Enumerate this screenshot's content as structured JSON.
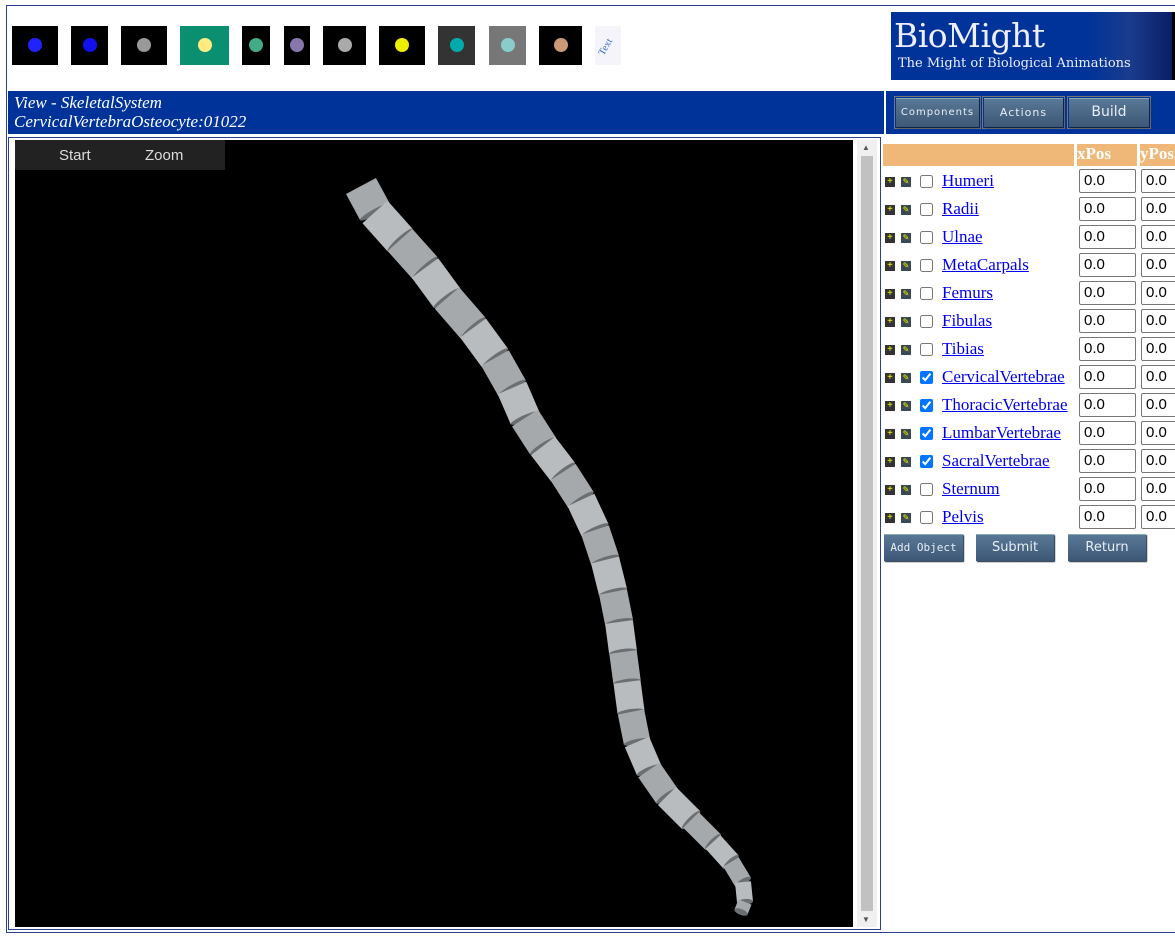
{
  "thumbnails": [
    {
      "name": "molecule-chain",
      "bg": "#000",
      "fg": "#22f"
    },
    {
      "name": "blue-spheres",
      "bg": "#000",
      "fg": "#11e"
    },
    {
      "name": "dna-helix",
      "bg": "#000",
      "fg": "#999"
    },
    {
      "name": "cell-diagram",
      "bg": "#0a9070",
      "fg": "#ffeb80"
    },
    {
      "name": "cell-small",
      "bg": "#000",
      "fg": "#4a8"
    },
    {
      "name": "cell-stack",
      "bg": "#000",
      "fg": "#87a"
    },
    {
      "name": "sphere-cell",
      "bg": "#000",
      "fg": "#aaa"
    },
    {
      "name": "colored-cubes",
      "bg": "#000",
      "fg": "#ee0"
    },
    {
      "name": "organ-model",
      "bg": "#333",
      "fg": "#0aa"
    },
    {
      "name": "lungs-model",
      "bg": "#777",
      "fg": "#8cc"
    },
    {
      "name": "human-torso",
      "bg": "#000",
      "fg": "#c97"
    },
    {
      "name": "text-icon",
      "bg": "#f4f4fa",
      "fg": "#36c",
      "label": "Text"
    }
  ],
  "logo": {
    "title": "BioMight",
    "subtitle": "The Might of Biological Animations"
  },
  "view": {
    "line1": "View - SkeletalSystem",
    "line2": "CervicalVertebraOsteocyte:01022"
  },
  "nav": {
    "components": "Components",
    "actions": "Actions",
    "build": "Build"
  },
  "viewer": {
    "start": "Start",
    "zoom": "Zoom"
  },
  "table": {
    "col_x": "xPos",
    "col_y": "yPos",
    "rows": [
      {
        "label": "Humeri",
        "checked": false,
        "x": "0.0",
        "y": "0.0"
      },
      {
        "label": "Radii",
        "checked": false,
        "x": "0.0",
        "y": "0.0"
      },
      {
        "label": "Ulnae",
        "checked": false,
        "x": "0.0",
        "y": "0.0"
      },
      {
        "label": "MetaCarpals",
        "checked": false,
        "x": "0.0",
        "y": "0.0"
      },
      {
        "label": "Femurs",
        "checked": false,
        "x": "0.0",
        "y": "0.0"
      },
      {
        "label": "Fibulas",
        "checked": false,
        "x": "0.0",
        "y": "0.0"
      },
      {
        "label": "Tibias",
        "checked": false,
        "x": "0.0",
        "y": "0.0"
      },
      {
        "label": "CervicalVertebrae",
        "checked": true,
        "x": "0.0",
        "y": "0.0"
      },
      {
        "label": "ThoracicVertebrae",
        "checked": true,
        "x": "0.0",
        "y": "0.0"
      },
      {
        "label": "LumbarVertebrae",
        "checked": true,
        "x": "0.0",
        "y": "0.0"
      },
      {
        "label": "SacralVertebrae",
        "checked": true,
        "x": "0.0",
        "y": "0.0"
      },
      {
        "label": "Sternum",
        "checked": false,
        "x": "0.0",
        "y": "0.0"
      },
      {
        "label": "Pelvis",
        "checked": false,
        "x": "0.0",
        "y": "0.0"
      }
    ]
  },
  "buttons": {
    "add": "Add Object",
    "submit": "Submit",
    "return": "Return"
  }
}
